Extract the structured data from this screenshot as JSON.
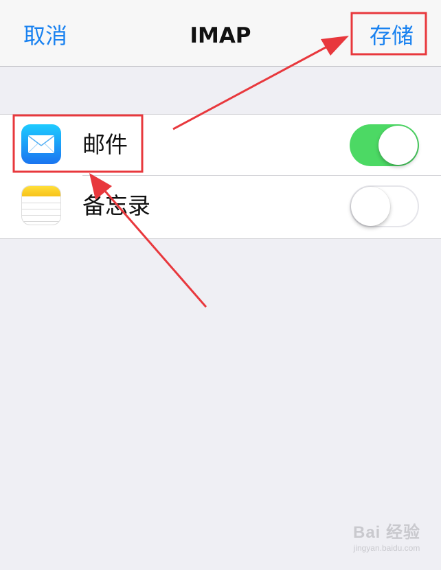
{
  "nav": {
    "cancel_label": "取消",
    "title": "IMAP",
    "save_label": "存储"
  },
  "rows": [
    {
      "label": "邮件",
      "icon": "mail-icon",
      "toggle_on": true
    },
    {
      "label": "备忘录",
      "icon": "notes-icon",
      "toggle_on": false
    }
  ],
  "colors": {
    "accent": "#1a82f0",
    "toggle_on": "#4cd964",
    "background": "#efeff4",
    "annotation": "#e8383d"
  },
  "watermark": {
    "main": "Bai 经验",
    "sub": "jingyan.baidu.com"
  }
}
